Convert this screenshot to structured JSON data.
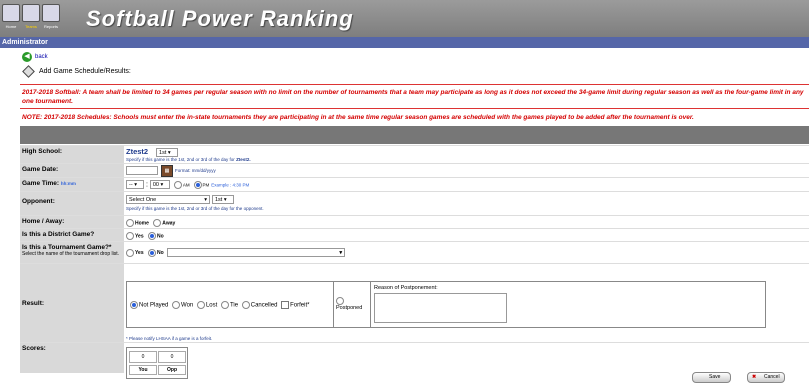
{
  "header": {
    "title": "Softball Power Ranking",
    "nav": [
      {
        "label": "Home"
      },
      {
        "label": "Teams"
      },
      {
        "label": "Reports"
      }
    ]
  },
  "admin_bar": "Administrator",
  "back_label": "back",
  "page_title": "Add Game Schedule/Results:",
  "notices": [
    "2017-2018 Softball: A team shall be limited to 34 games per regular season with no limit on the number of tournaments that a team may participate as long as it does not exceed the 34-game limit during regular season as well as the four-game limit in any one tournament.",
    "NOTE: 2017-2018 Schedules: Schools must enter the in-state tournaments they are participating in at the same time regular season games are scheduled with the games played to be added after the tournament is over."
  ],
  "form": {
    "high_school": {
      "label": "High School:",
      "school": "Ztest2",
      "game_num": "1st",
      "help_prefix": "Specify if this game is the 1st, 2nd or 3rd of the day for ",
      "help_school": "Ztest2."
    },
    "game_date": {
      "label": "Game Date:",
      "value": "",
      "format": "Format: mm/dd/yyyy"
    },
    "game_time": {
      "label": "Game Time:",
      "label_hint": "hh:mm",
      "hour": "--",
      "minute": "00",
      "am": "AM",
      "pm": "PM",
      "example": "Example : 4:30 PM"
    },
    "opponent": {
      "label": "Opponent:",
      "select": "Select One",
      "game_num": "1st",
      "help": "Specify if this game is the 1st, 2nd or 3rd of the day for the opponent."
    },
    "home_away": {
      "label": "Home / Away:",
      "home": "Home",
      "away": "Away"
    },
    "district": {
      "label": "Is this a District Game?",
      "yes": "Yes",
      "no": "No"
    },
    "tournament": {
      "label": "Is this a Tournament Game?*",
      "sub": "Select the name of the tournament drop list.",
      "yes": "Yes",
      "no": "No",
      "select": ""
    },
    "result": {
      "label": "Result:",
      "options": [
        "Not Played",
        "Won",
        "Lost",
        "Tie",
        "Cancelled"
      ],
      "forfeit": "Forfeit*",
      "postponed": "Postponed",
      "reason_label": "Reason of Postponement:",
      "note": "* Please notify LHSAA if a game is a forfeit."
    },
    "scores": {
      "label": "Scores:",
      "you_value": "0",
      "opp_value": "0",
      "you": "You",
      "opp": "Opp"
    }
  },
  "buttons": {
    "save": "Save",
    "cancel": "Cancel"
  }
}
